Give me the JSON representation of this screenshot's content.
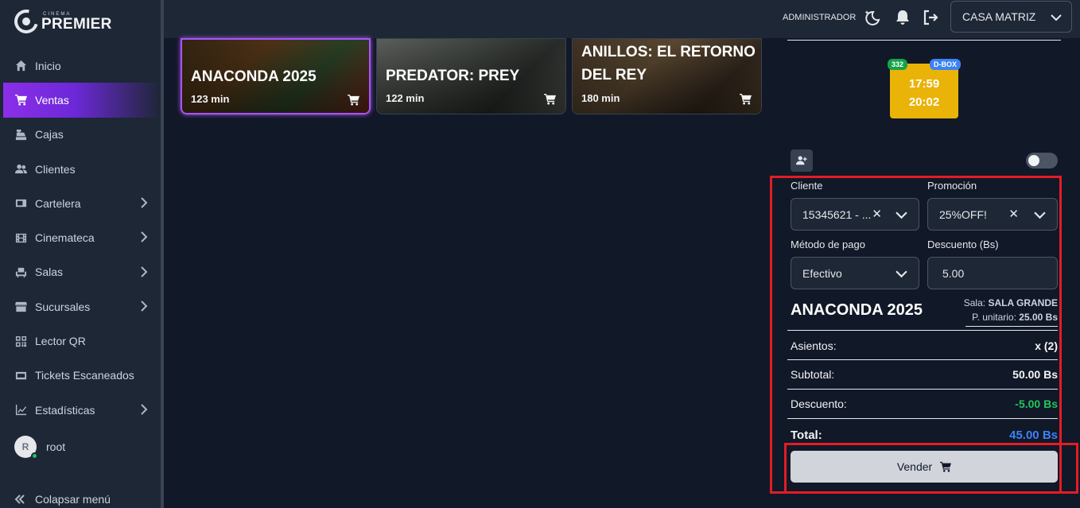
{
  "brand": {
    "small": "CINEMA",
    "name": "PREMIER"
  },
  "sidebar": {
    "items": [
      {
        "label": "Inicio",
        "icon": "home-icon",
        "chevron": false
      },
      {
        "label": "Ventas",
        "icon": "cart-icon",
        "chevron": false,
        "active": true
      },
      {
        "label": "Cajas",
        "icon": "cash-register-icon",
        "chevron": false
      },
      {
        "label": "Clientes",
        "icon": "users-icon",
        "chevron": false
      },
      {
        "label": "Cartelera",
        "icon": "ticket-icon",
        "chevron": true
      },
      {
        "label": "Cinemateca",
        "icon": "film-icon",
        "chevron": true
      },
      {
        "label": "Salas",
        "icon": "seat-icon",
        "chevron": true
      },
      {
        "label": "Sucursales",
        "icon": "store-icon",
        "chevron": true
      },
      {
        "label": "Lector QR",
        "icon": "qr-icon",
        "chevron": false
      },
      {
        "label": "Tickets Escaneados",
        "icon": "scanned-ticket-icon",
        "chevron": false
      },
      {
        "label": "Estadísticas",
        "icon": "chart-icon",
        "chevron": true
      }
    ],
    "user": {
      "initial": "R",
      "name": "root"
    },
    "collapse_label": "Colapsar menú"
  },
  "header": {
    "role": "ADMINISTRADOR",
    "branch": "CASA MATRIZ"
  },
  "movies": [
    {
      "title": "ANACONDA 2025",
      "duration": "123 min",
      "selected": true
    },
    {
      "title": "PREDATOR: PREY",
      "duration": "122 min",
      "selected": false
    },
    {
      "title": "ANILLOS: EL RETORNO DEL REY",
      "title_line1": "ANILLOS: EL RETORNO",
      "title_line2": "DEL REY",
      "duration": "180 min",
      "selected": false
    }
  ],
  "showtime": {
    "badge_left": "332",
    "badge_right": "D-BOX",
    "time1": "17:59",
    "time2": "20:02"
  },
  "form": {
    "cliente_label": "Cliente",
    "cliente_value": "15345621 - ...",
    "promocion_label": "Promoción",
    "promocion_value": "25%OFF!",
    "metodo_label": "Método de pago",
    "metodo_value": "Efectivo",
    "descuento_label": "Descuento (Bs)",
    "descuento_value": "5.00"
  },
  "summary": {
    "movie": "ANACONDA 2025",
    "sala_label": "Sala:",
    "sala_value": "SALA GRANDE",
    "precio_label": "P. unitario:",
    "precio_value": "25.00 Bs",
    "asientos_label": "Asientos:",
    "asientos_value": "x (2)",
    "subtotal_label": "Subtotal:",
    "subtotal_value": "50.00 Bs",
    "descuento_label": "Descuento:",
    "descuento_value": "-5.00 Bs",
    "total_label": "Total:",
    "total_value": "45.00 Bs"
  },
  "sell_button": "Vender",
  "colors": {
    "accent": "#8b2fe8",
    "discount": "#22c55e",
    "total": "#3b82f6",
    "highlight": "#e11d26",
    "showtime": "#eab308"
  }
}
